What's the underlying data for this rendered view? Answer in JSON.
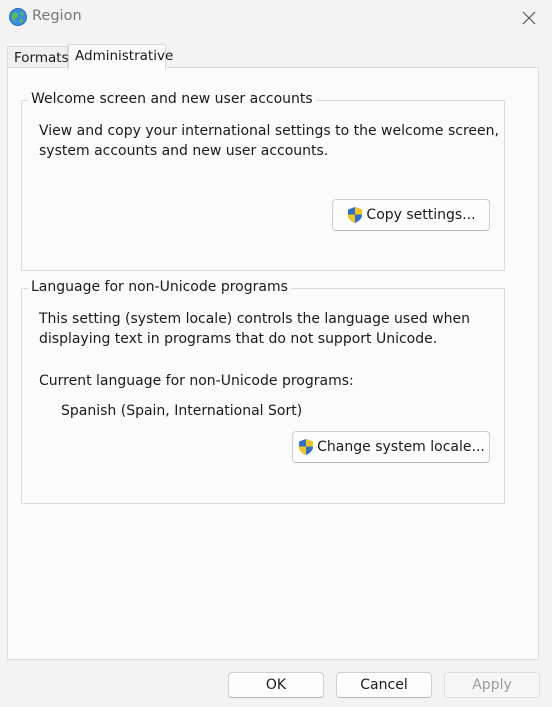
{
  "window": {
    "title": "Region",
    "app_icon": "globe-icon",
    "close_icon": "close-icon"
  },
  "tabs": [
    {
      "label": "Formats",
      "selected": false
    },
    {
      "label": "Administrative",
      "selected": true
    }
  ],
  "welcome_group": {
    "title": "Welcome screen and new user accounts",
    "description_line1": "View and copy your international settings to the welcome screen,",
    "description_line2": "system accounts and new user accounts.",
    "copy_button_label": "Copy settings...",
    "button_icon": "uac-shield-icon"
  },
  "unicode_group": {
    "title": "Language for non-Unicode programs",
    "description_line1": "This setting (system locale) controls the language used when",
    "description_line2": "displaying text in programs that do not support Unicode.",
    "current_label": "Current language for non-Unicode programs:",
    "current_value": "Spanish (Spain, International Sort)",
    "change_button_label": "Change system locale...",
    "button_icon": "uac-shield-icon"
  },
  "footer": {
    "ok_label": "OK",
    "cancel_label": "Cancel",
    "apply_label": "Apply",
    "apply_enabled": false
  },
  "colors": {
    "window_bg": "#f3f3f3",
    "panel_bg": "#fbfbfb",
    "border": "#dcdcdc",
    "disabled_text": "#9c9c9c"
  }
}
